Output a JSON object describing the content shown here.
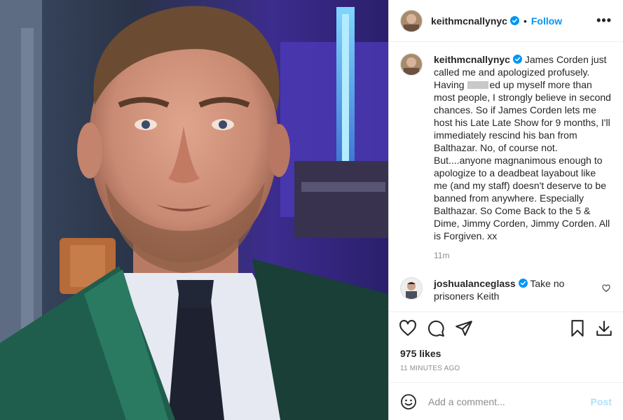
{
  "post": {
    "author": "keithmcnallynyc",
    "follow_label": "Follow",
    "dot": "•",
    "more_label": "•••"
  },
  "caption": {
    "username": "keithmcnallynyc",
    "text_before": " James Corden just called me and apologized profusely. Having ",
    "text_after": "ed up myself more than most people, I strongly believe in second chances. So if James Corden lets me host his Late Late Show for 9 months, I'll immediately rescind his ban from Balthazar. No, of course not. But....anyone magnanimous enough to apologize to a deadbeat layabout like me (and my staff) doesn't deserve to be banned from anywhere. Especially Balthazar. So Come Back to the 5 & Dime, Jimmy Corden, Jimmy Corden. All is Forgiven. xx",
    "time": "11m"
  },
  "reply": {
    "username": "joshualanceglass",
    "text": " Take no prisoners Keith"
  },
  "stats": {
    "likes": "975 likes",
    "posted_ago": "11 MINUTES AGO"
  },
  "composer": {
    "placeholder": "Add a comment...",
    "post_label": "Post"
  },
  "icons": {
    "verified": "verified-badge-icon",
    "like": "heart-icon",
    "comment": "comment-icon",
    "share": "share-icon",
    "save": "bookmark-icon",
    "download": "download-icon",
    "emoji": "emoji-icon"
  },
  "colors": {
    "accent": "#0095f6",
    "post_disabled": "#b2dffc",
    "jacket": "#1f5e4c",
    "backdrop": "#3b2f8c"
  }
}
